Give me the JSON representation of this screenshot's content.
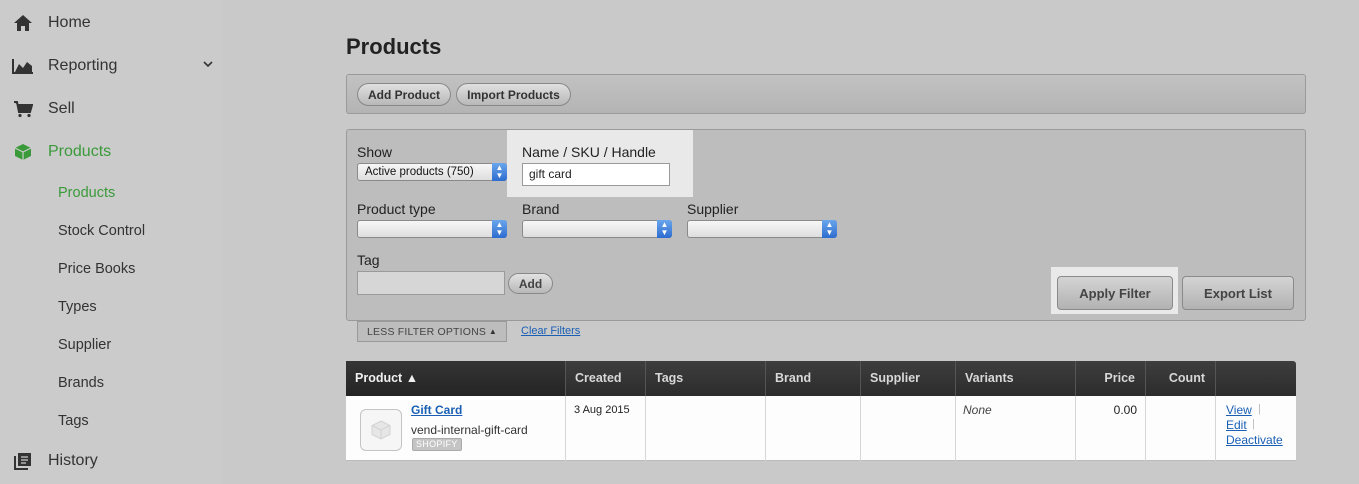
{
  "sidebar": {
    "items": [
      {
        "label": "Home",
        "icon": "home-icon"
      },
      {
        "label": "Reporting",
        "icon": "chart-icon"
      },
      {
        "label": "Sell",
        "icon": "cart-icon"
      },
      {
        "label": "Products",
        "icon": "box-icon"
      },
      {
        "label": "History",
        "icon": "history-icon"
      }
    ],
    "sub_items": [
      "Products",
      "Stock Control",
      "Price Books",
      "Types",
      "Supplier",
      "Brands",
      "Tags"
    ],
    "active_color": "#3a9a3a"
  },
  "page": {
    "title": "Products"
  },
  "toolbar": {
    "add_product": "Add Product",
    "import_products": "Import Products"
  },
  "filters": {
    "show_label": "Show",
    "show_value": "Active products (750)",
    "name_label": "Name / SKU / Handle",
    "name_value": "gift card",
    "product_type_label": "Product type",
    "brand_label": "Brand",
    "supplier_label": "Supplier",
    "tag_label": "Tag",
    "tag_add": "Add",
    "apply_filter": "Apply Filter",
    "export_list": "Export List",
    "less_options": "LESS FILTER OPTIONS",
    "clear_filters": "Clear Filters"
  },
  "table": {
    "columns": [
      "Product ▲",
      "Created",
      "Tags",
      "Brand",
      "Supplier",
      "Variants",
      "Price",
      "Count",
      ""
    ],
    "rows": [
      {
        "name": "Gift Card",
        "handle": "vend-internal-gift-card",
        "badge": "SHOPIFY",
        "created": "3 Aug 2015",
        "tags": "",
        "brand": "",
        "supplier": "",
        "variants": "None",
        "price": "0.00",
        "count": "",
        "actions": [
          "View",
          "Edit",
          "Deactivate"
        ]
      }
    ]
  }
}
